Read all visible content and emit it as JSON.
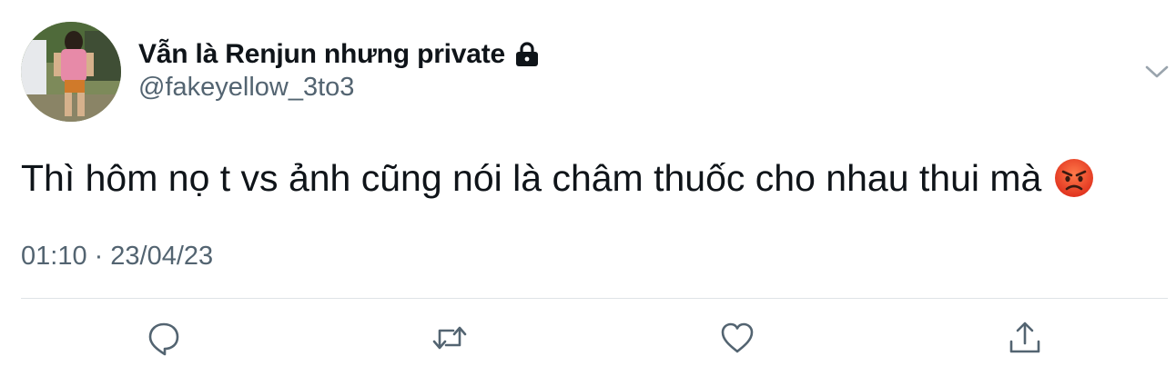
{
  "tweet": {
    "author": {
      "display_name": "Vẫn là Renjun nhưng private",
      "handle": "@fakeyellow_3to3",
      "protected_icon": "lock-icon",
      "avatar": "profile-photo"
    },
    "text": "Thì hôm nọ t vs ảnh cũng nói là châm thuốc cho nhau thui mà",
    "emoji": "angry-face-emoji",
    "time": "01:10",
    "separator": "·",
    "date": "23/04/23",
    "more_icon": "chevron-down-icon"
  },
  "actions": [
    {
      "name": "reply",
      "icon": "reply-icon"
    },
    {
      "name": "retweet",
      "icon": "retweet-icon"
    },
    {
      "name": "like",
      "icon": "heart-icon"
    },
    {
      "name": "share",
      "icon": "share-icon"
    }
  ],
  "colors": {
    "text_primary": "#0f1419",
    "text_secondary": "#536471",
    "divider": "#dfe3e6",
    "icon": "#536471"
  }
}
